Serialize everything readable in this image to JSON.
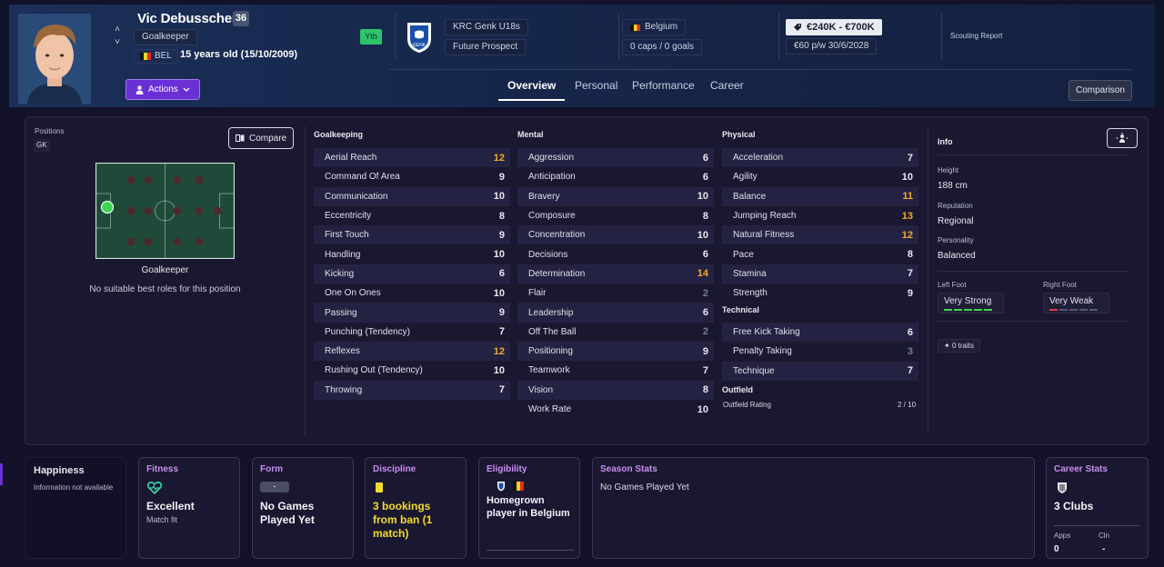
{
  "header": {
    "player_name": "Vic Debusschere",
    "squad_number": "36",
    "position": "Goalkeeper",
    "nationality_code": "BEL",
    "age_text": "15 years old (15/10/2009)",
    "youth_badge": "Yth",
    "club": "KRC Genk U18s",
    "status": "Future Prospect",
    "country": "Belgium",
    "caps": "0 caps / 0 goals",
    "value": "€240K - €700K",
    "wage": "€60 p/w 30/6/2028",
    "scouting_report": "Scouting Report",
    "actions_label": "Actions",
    "comparison_label": "Comparison",
    "tabs": [
      {
        "label": "Overview"
      },
      {
        "label": "Personal"
      },
      {
        "label": "Performance"
      },
      {
        "label": "Career"
      }
    ]
  },
  "positions": {
    "title": "Positions",
    "chip": "GK",
    "compare_label": "Compare",
    "role_label": "Goalkeeper",
    "role_note": "No suitable best roles for this position"
  },
  "goalkeeping": {
    "title": "Goalkeeping",
    "items": [
      {
        "name": "Aerial Reach",
        "value": "12"
      },
      {
        "name": "Command Of Area",
        "value": "9"
      },
      {
        "name": "Communication",
        "value": "10"
      },
      {
        "name": "Eccentricity",
        "value": "8"
      },
      {
        "name": "First Touch",
        "value": "9"
      },
      {
        "name": "Handling",
        "value": "10"
      },
      {
        "name": "Kicking",
        "value": "6"
      },
      {
        "name": "One On Ones",
        "value": "10"
      },
      {
        "name": "Passing",
        "value": "9"
      },
      {
        "name": "Punching (Tendency)",
        "value": "7"
      },
      {
        "name": "Reflexes",
        "value": "12"
      },
      {
        "name": "Rushing Out (Tendency)",
        "value": "10"
      },
      {
        "name": "Throwing",
        "value": "7"
      }
    ]
  },
  "mental": {
    "title": "Mental",
    "items": [
      {
        "name": "Aggression",
        "value": "6"
      },
      {
        "name": "Anticipation",
        "value": "6"
      },
      {
        "name": "Bravery",
        "value": "10"
      },
      {
        "name": "Composure",
        "value": "8"
      },
      {
        "name": "Concentration",
        "value": "10"
      },
      {
        "name": "Decisions",
        "value": "6"
      },
      {
        "name": "Determination",
        "value": "14"
      },
      {
        "name": "Flair",
        "value": "2"
      },
      {
        "name": "Leadership",
        "value": "6"
      },
      {
        "name": "Off The Ball",
        "value": "2"
      },
      {
        "name": "Positioning",
        "value": "9"
      },
      {
        "name": "Teamwork",
        "value": "7"
      },
      {
        "name": "Vision",
        "value": "8"
      },
      {
        "name": "Work Rate",
        "value": "10"
      }
    ]
  },
  "physical": {
    "title": "Physical",
    "items": [
      {
        "name": "Acceleration",
        "value": "7"
      },
      {
        "name": "Agility",
        "value": "10"
      },
      {
        "name": "Balance",
        "value": "11"
      },
      {
        "name": "Jumping Reach",
        "value": "13"
      },
      {
        "name": "Natural Fitness",
        "value": "12"
      },
      {
        "name": "Pace",
        "value": "8"
      },
      {
        "name": "Stamina",
        "value": "7"
      },
      {
        "name": "Strength",
        "value": "9"
      }
    ]
  },
  "technical": {
    "title": "Technical",
    "items": [
      {
        "name": "Free Kick Taking",
        "value": "6"
      },
      {
        "name": "Penalty Taking",
        "value": "3"
      },
      {
        "name": "Technique",
        "value": "7"
      }
    ]
  },
  "outfield": {
    "title": "Outfield",
    "label": "Outfield Rating",
    "value": "2 / 10"
  },
  "info": {
    "title": "Info",
    "height_label": "Height",
    "height_value": "188 cm",
    "reputation_label": "Reputation",
    "reputation_value": "Regional",
    "personality_label": "Personality",
    "personality_value": "Balanced",
    "left_foot_label": "Left Foot",
    "left_foot_value": "Very Strong",
    "left_foot_level": 5,
    "right_foot_label": "Right Foot",
    "right_foot_value": "Very Weak",
    "right_foot_level": 1,
    "traits": "0 traits"
  },
  "cards": {
    "happiness": {
      "title": "Happiness",
      "text": "Information not available"
    },
    "fitness": {
      "title": "Fitness",
      "value": "Excellent",
      "sub": "Match fit"
    },
    "form": {
      "title": "Form",
      "chip": "-",
      "value": "No Games Played Yet"
    },
    "discipline": {
      "title": "Discipline",
      "value": "3 bookings from ban (1 match)"
    },
    "eligibility": {
      "title": "Eligibility",
      "value": "Homegrown player in Belgium"
    },
    "season_stats": {
      "title": "Season Stats",
      "text": "No Games Played Yet"
    },
    "career_stats": {
      "title": "Career Stats",
      "value": "3 Clubs",
      "apps_label": "Apps",
      "apps_value": "0",
      "cln_label": "Cln",
      "cln_value": "-"
    }
  },
  "colors": {
    "accent_purple": "#6b2fd6",
    "highlight_orange": "#f4a92d",
    "youth_green": "#2fc36a",
    "card_title": "#c98ef0",
    "discipline_yellow": "#f4dc2e"
  }
}
